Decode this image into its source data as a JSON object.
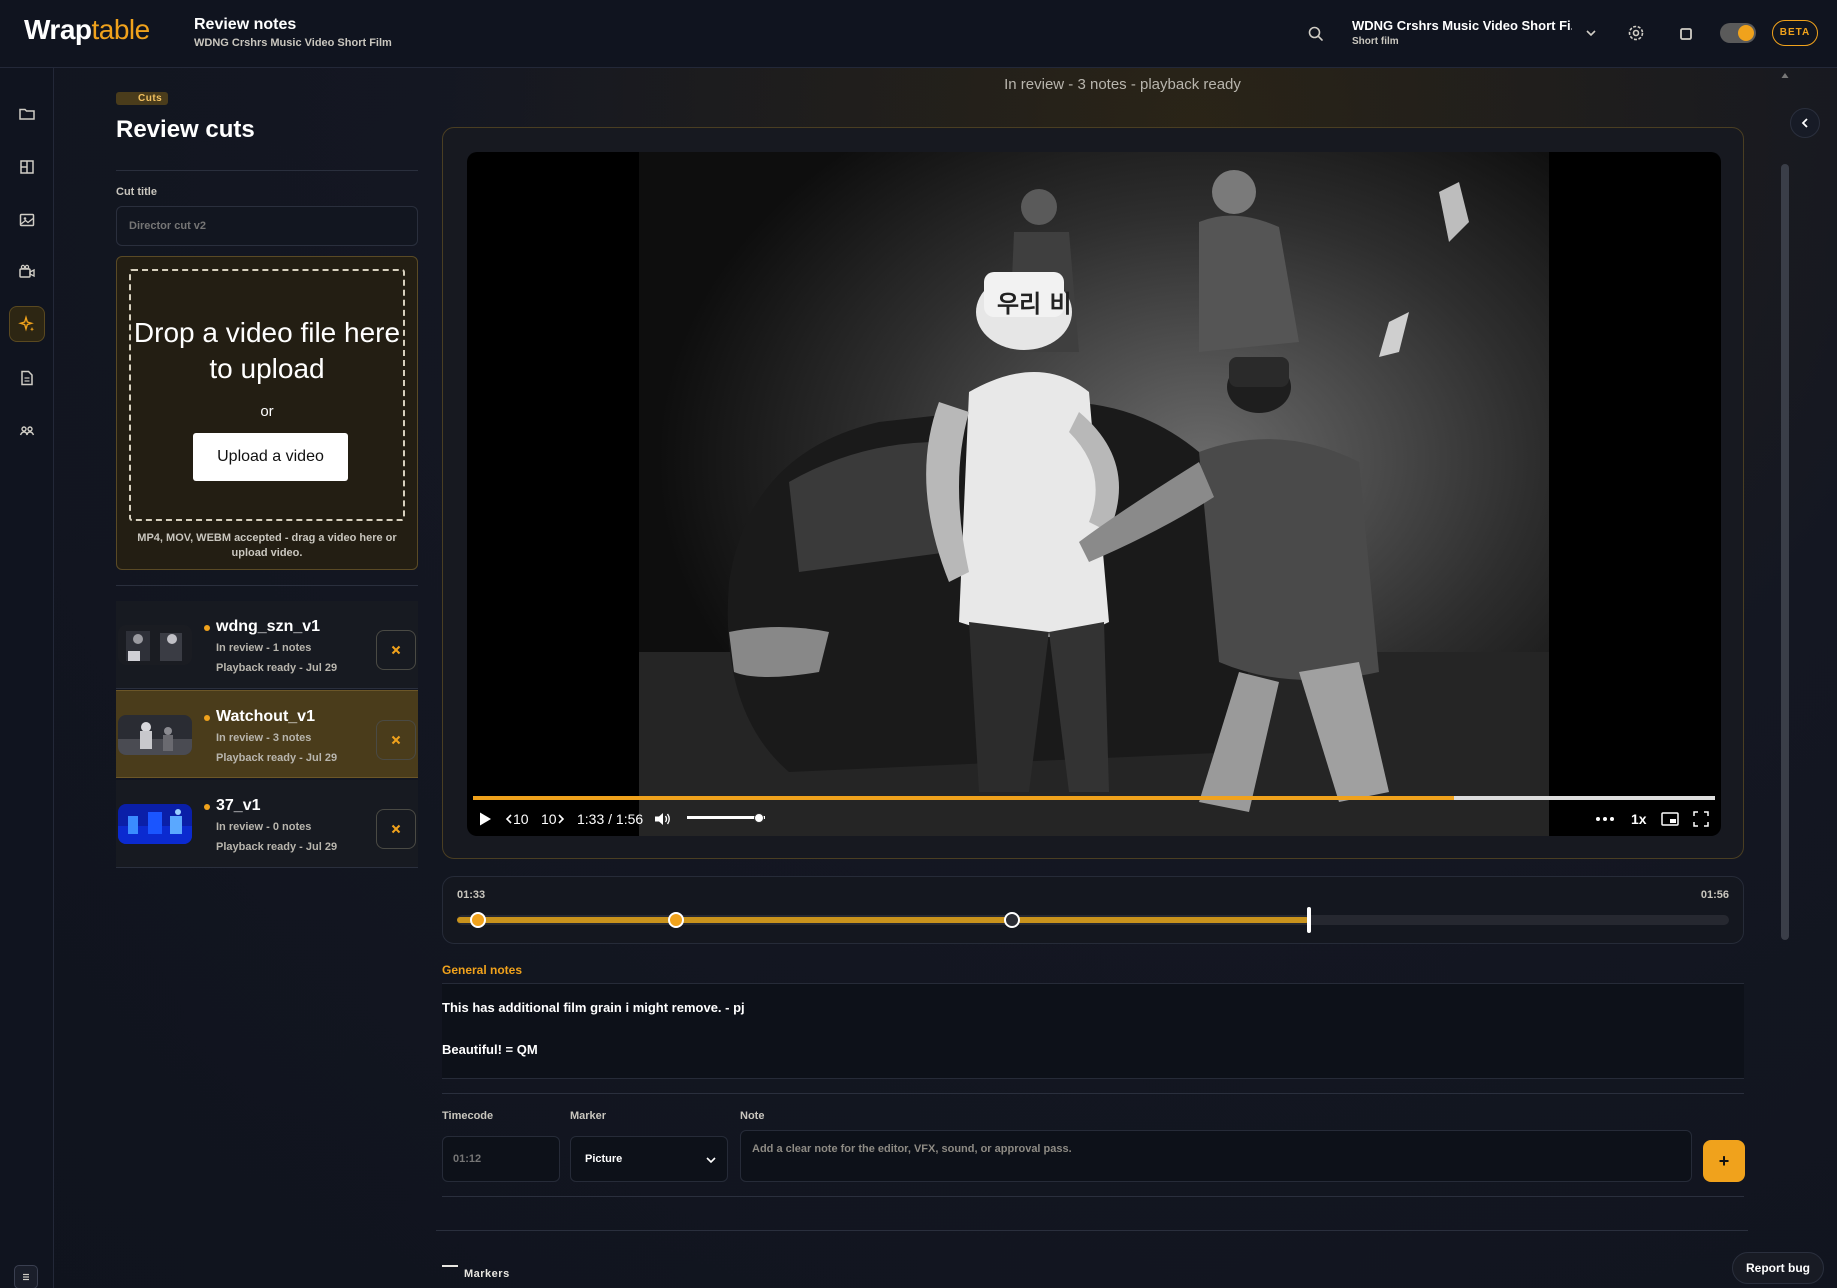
{
  "app": {
    "logo_main": "Wrap",
    "logo_accent": "table"
  },
  "header": {
    "title": "Review notes",
    "subtitle": "WDNG Crshrs Music Video Short Film",
    "project_name": "WDNG Crshrs Music Video Short Fi...",
    "project_type": "Short film",
    "beta_label": "BETA"
  },
  "sidebar": {
    "items": [
      {
        "name": "folder-icon"
      },
      {
        "name": "layout-icon"
      },
      {
        "name": "image-icon"
      },
      {
        "name": "camera-icon"
      },
      {
        "name": "sparkle-icon",
        "active": true
      },
      {
        "name": "document-icon"
      },
      {
        "name": "people-icon"
      }
    ]
  },
  "left_panel": {
    "badge": "Cuts",
    "heading": "Review cuts",
    "cut_title_label": "Cut title",
    "cut_title_placeholder": "Director cut v2",
    "drop_title": "Drop a video file here to upload",
    "drop_or": "or",
    "upload_button": "Upload a video",
    "drop_note": "MP4, MOV, WEBM accepted - drag a video here or upload video.",
    "cuts": [
      {
        "name": "wdng_szn_v1",
        "status": "In review - 1 notes",
        "playback": "Playback ready - Jul 29",
        "selected": false
      },
      {
        "name": "Watchout_v1",
        "status": "In review - 3 notes",
        "playback": "Playback ready - Jul 29",
        "selected": true
      },
      {
        "name": "37_v1",
        "status": "In review - 0 notes",
        "playback": "Playback ready - Jul 29",
        "selected": false
      }
    ]
  },
  "main": {
    "status_line": "In review - 3 notes - playback ready",
    "player": {
      "time": "1:33 / 1:56",
      "progress": 0.79,
      "volume": 0.92,
      "rewind_label": "10",
      "forward_label": "10",
      "speed": "1x",
      "video_text": "우리 비"
    },
    "timeline": {
      "start": "01:33",
      "end": "01:56",
      "playhead": 0.67,
      "markers": [
        0.01,
        0.166,
        0.43
      ]
    },
    "general_notes_label": "General notes",
    "general_notes": [
      "This has additional film grain i might remove. - pj",
      "Beautiful! = QM"
    ],
    "form": {
      "timecode_label": "Timecode",
      "timecode_placeholder": "01:12",
      "marker_label": "Marker",
      "marker_value": "Picture",
      "note_label": "Note",
      "note_placeholder": "Add a clear note for the editor, VFX, sound, or approval pass.",
      "add_label": "+"
    },
    "markers_heading": "Markers"
  },
  "report_bug": "Report bug",
  "colors": {
    "accent": "#f0a21c",
    "bg": "#10141f"
  }
}
